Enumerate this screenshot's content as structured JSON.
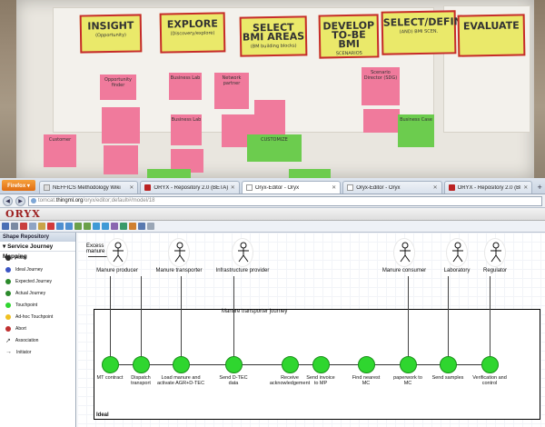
{
  "photo": {
    "stages": [
      {
        "big": "INSIGHT",
        "small": "(Opportunity)"
      },
      {
        "big": "EXPLORE",
        "small": "(Discovery/explore)"
      },
      {
        "big": "SELECT BMI AREAS",
        "small": "(BM building blocks)"
      },
      {
        "big": "DEVELOP TO-BE BMI",
        "small": "SCENARIOS"
      },
      {
        "big": "SELECT/DEFINE",
        "small": "(AND) BMI SCEN."
      },
      {
        "big": "EVALUATE",
        "small": ""
      }
    ],
    "notes": [
      {
        "text": "Opportunity finder"
      },
      {
        "text": "Business Lab"
      },
      {
        "text": "Network partner"
      },
      {
        "text": "Scenario Director (SDG)"
      },
      {
        "text": "Customer"
      },
      {
        "text": "Business Lab"
      },
      {
        "text": "CUSTOMIZE"
      },
      {
        "text": "Business Case"
      }
    ]
  },
  "browser": {
    "firefox_label": "Firefox ▾",
    "tabs": [
      {
        "label": "NEFFICS Methodology Wiki",
        "active": false
      },
      {
        "label": "ORYX - Repository 2.0 (BETA)",
        "active": false
      },
      {
        "label": "Oryx-Editor - Oryx",
        "active": true
      },
      {
        "label": "Oryx-Editor - Oryx",
        "active": false
      },
      {
        "label": "ORYX - Repository 2.0 (BETA)",
        "active": false
      }
    ],
    "url_prefix": "tomcat.",
    "url_host": "thingml.org",
    "url_rest": "/oryx/editor;default#/model/18"
  },
  "app": {
    "logo": "ORYX",
    "shape_repository": "Shape Repository",
    "group": "Service Journey Mapping",
    "shapes": [
      {
        "label": "Actor",
        "color": "#2a2a2a"
      },
      {
        "label": "Ideal Journey",
        "color": "#3b55c4"
      },
      {
        "label": "Expected Journey",
        "color": "#2b8a2b"
      },
      {
        "label": "Actual Journey",
        "color": "#2b8a2b"
      },
      {
        "label": "Touchpoint",
        "color": "#2fd62f"
      },
      {
        "label": "Ad-hoc Touchpoint",
        "color": "#f0c020"
      },
      {
        "label": "Abort",
        "color": "#c03030"
      },
      {
        "label": "Association",
        "color": "#444444"
      },
      {
        "label": "Initiator",
        "color": "#444444"
      }
    ]
  },
  "diagram": {
    "excess_manure": "Excess manure",
    "actors": [
      "Manure producer",
      "Manure transporter",
      "Infrastructure provider",
      "Manure consumer",
      "Laboratory",
      "Regulator"
    ],
    "journey_title": "Manure transporter journey",
    "journey_type": "Ideal",
    "touchpoints": [
      "MT contract",
      "Dispatch transport",
      "Load manure and activate AGR+D-TEC",
      "Send D-TEC data",
      "Receive acknowledgement",
      "Send invoice to MP",
      "Find nearest MC",
      "paperwork to MC",
      "Send samples",
      "Verification and control"
    ]
  }
}
